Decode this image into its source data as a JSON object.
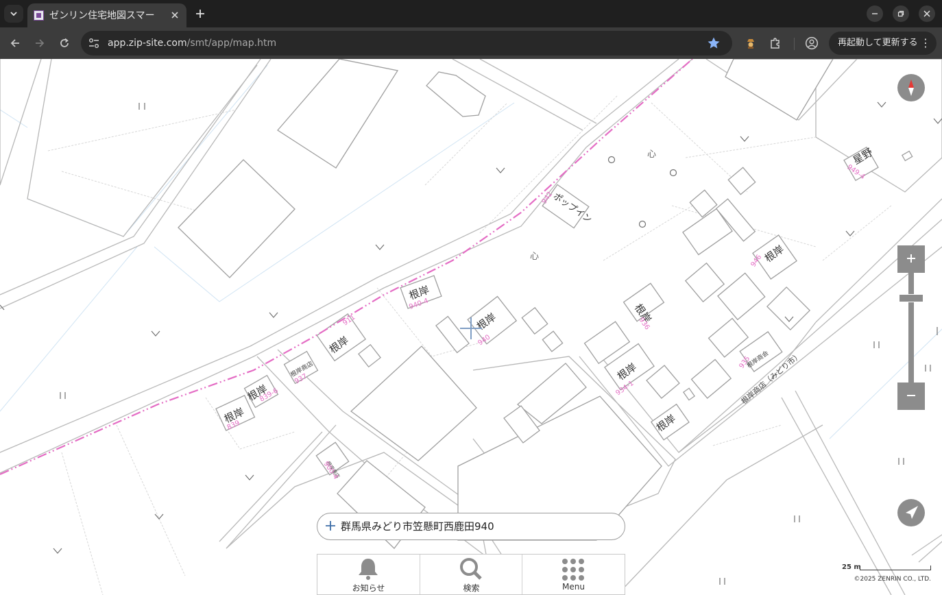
{
  "browser": {
    "tab_title": "ゼンリン住宅地図スマー",
    "url_host": "app.zip-site.com",
    "url_path": "/smt/app/map.htm",
    "relaunch_label": "再起動して更新する"
  },
  "map": {
    "labels": {
      "b940": "根岸",
      "b940_4": "根岸",
      "b_center": "根岸",
      "b_neg_sm": "根岸",
      "b839": "根岸",
      "b839_6": "根岸",
      "b934": "根岸",
      "b936": "根岸",
      "b946": "根岸",
      "b_south": "根岸",
      "b942": "ポップイン",
      "b949": "星野",
      "b_negishi_shoten": "根岸商店",
      "b_negishi_sanka": "根岸商会",
      "b_bottom_small": "根岸商店",
      "b_negishi_ten": "根岸商店（みどり市）"
    },
    "parcels": {
      "p940": "940",
      "p940_4": "940-4",
      "p937": "937",
      "p839": "839",
      "p839_6": "839-6",
      "p934_1": "934-1",
      "p936": "936",
      "p946": "946",
      "p942": "942",
      "p949": "949-4",
      "p900": "900-4",
      "p935": "935"
    }
  },
  "search": {
    "address": "群馬県みどり市笠懸町西鹿田940"
  },
  "nav": {
    "notice": "お知らせ",
    "search": "検索",
    "menu": "Menu"
  },
  "scale_label": "25 m",
  "copyright": "©2025 ZENRIN CO., LTD."
}
